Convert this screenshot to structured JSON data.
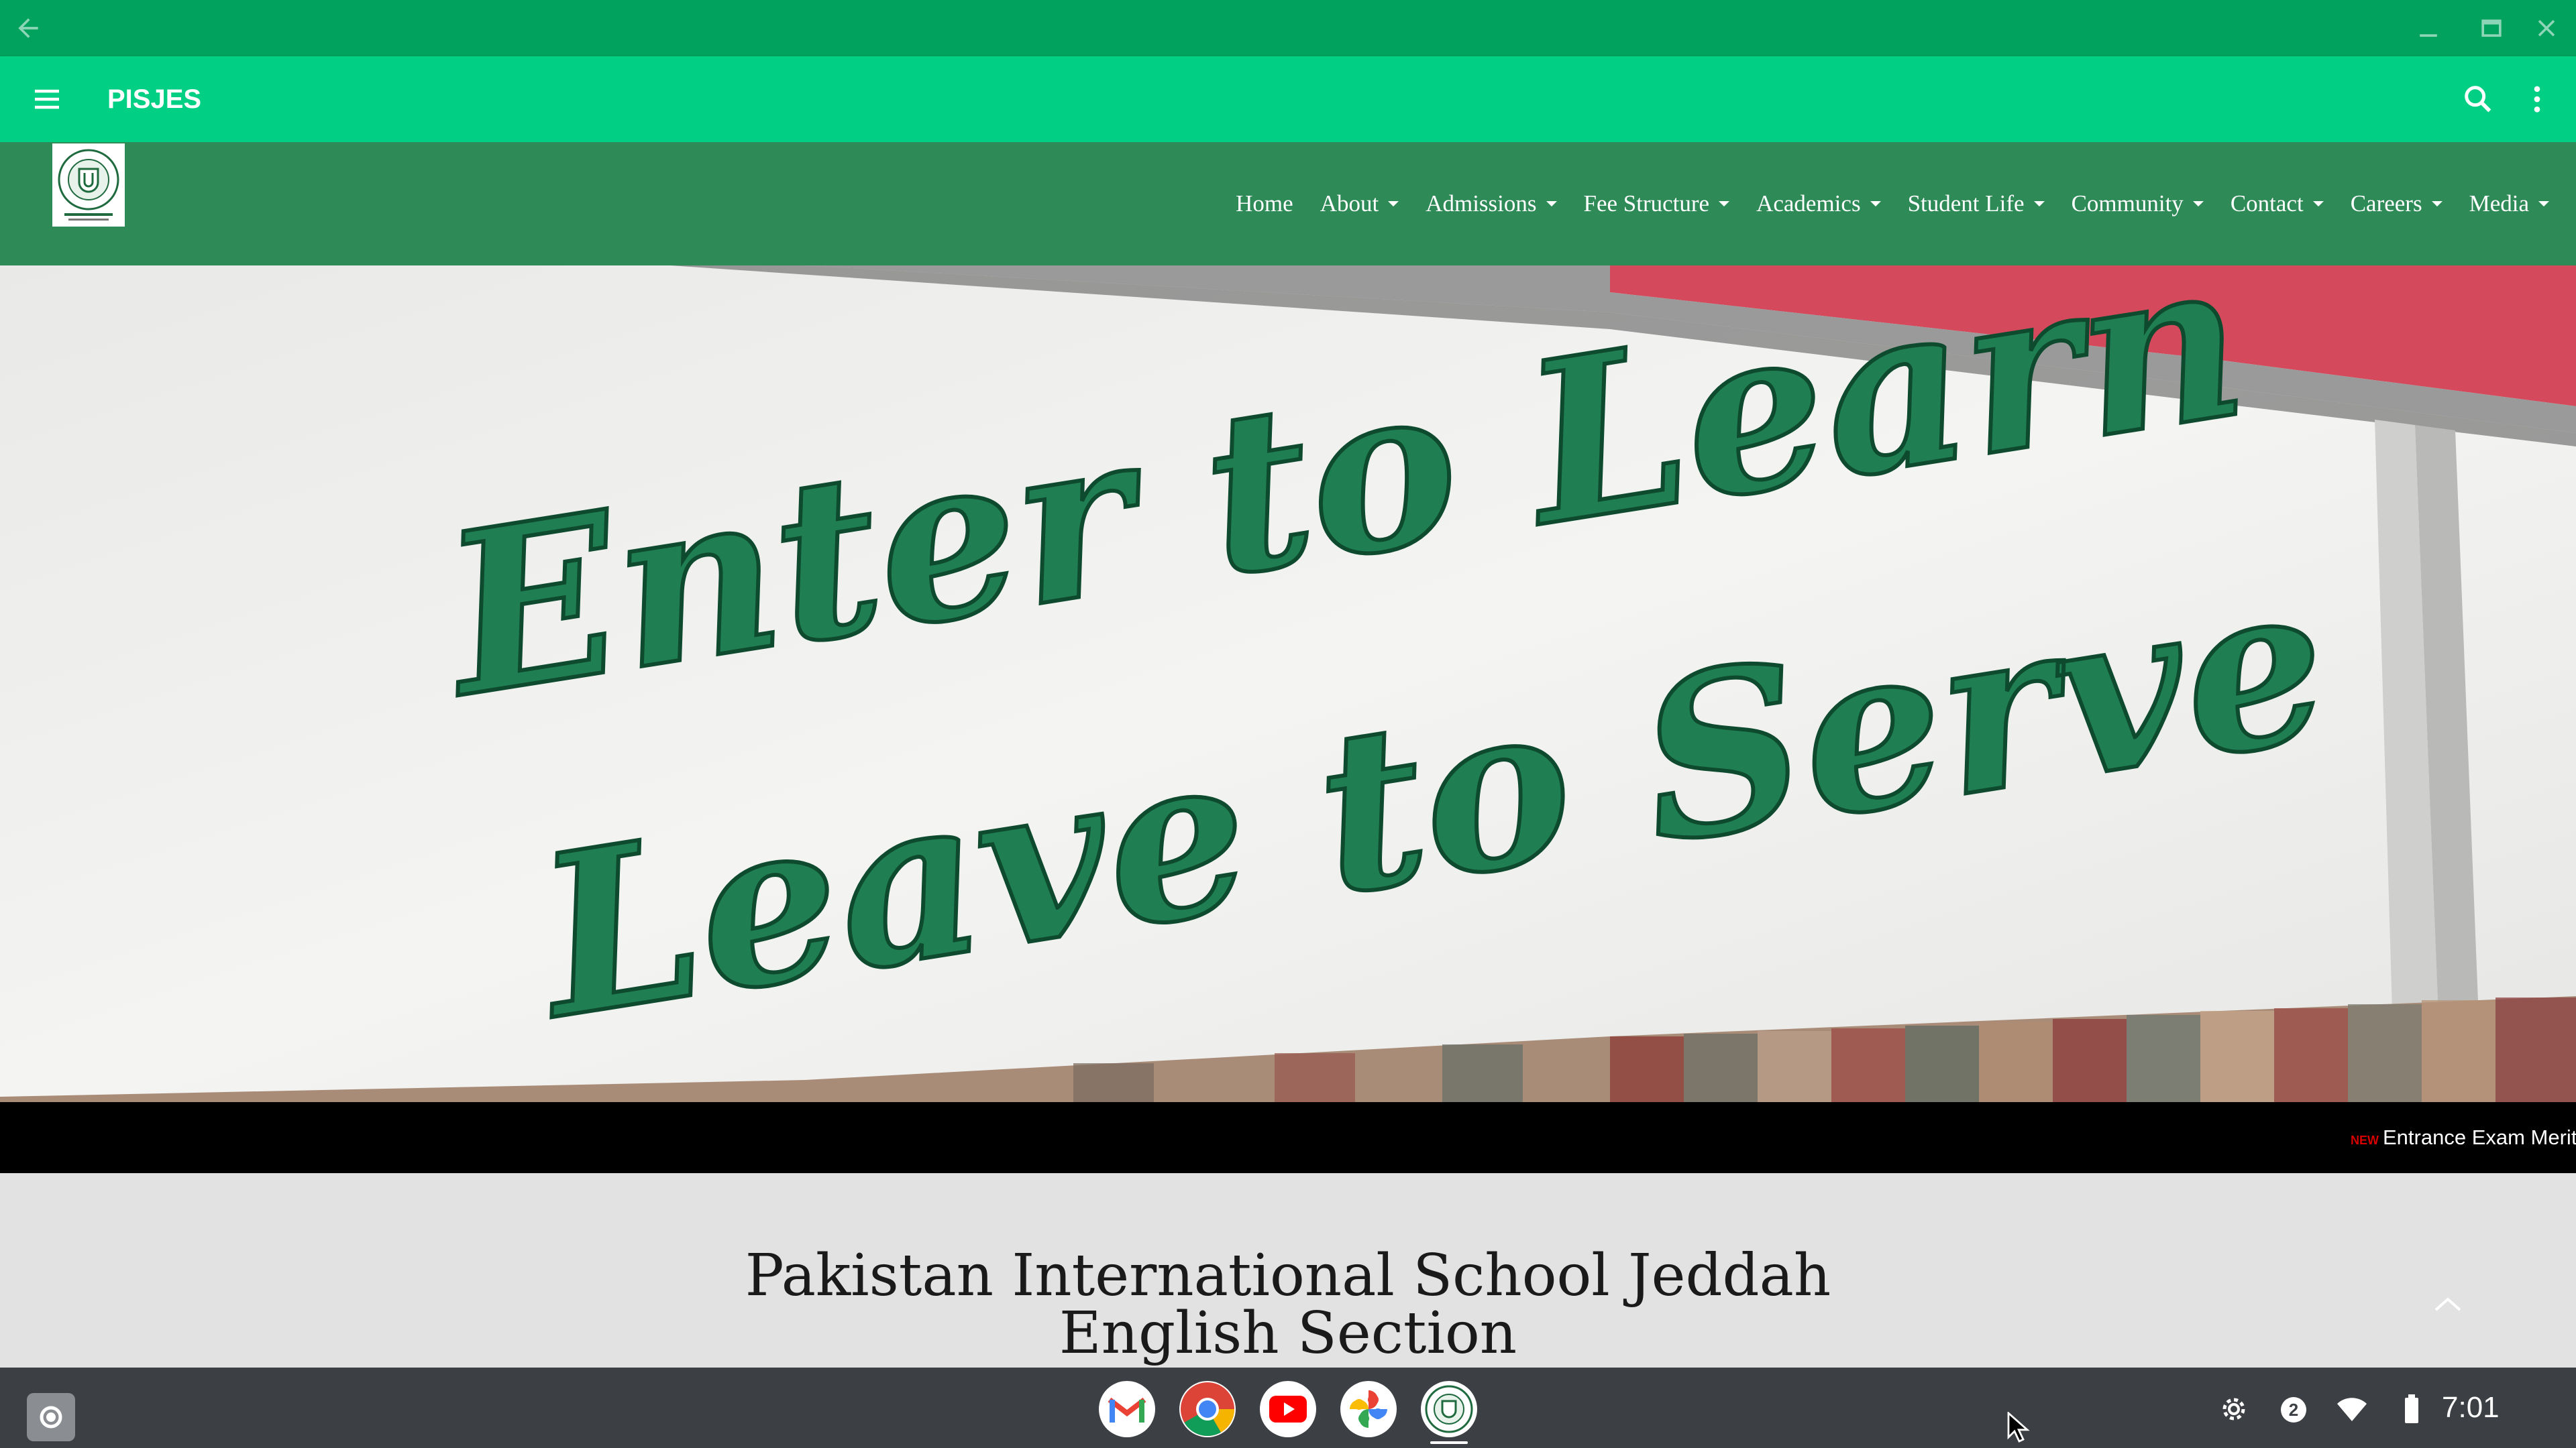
{
  "window": {
    "controls": [
      "back-arrow-icon",
      "minimize-icon",
      "restore-icon",
      "close-icon"
    ]
  },
  "appbar": {
    "title": "PISJES",
    "icons": [
      "hamburger-menu-icon",
      "search-icon",
      "more-vert-icon"
    ]
  },
  "site": {
    "logo_alt": "Pakistan International School Jeddah logo",
    "nav": [
      {
        "label": "Home",
        "dropdown": false
      },
      {
        "label": "About",
        "dropdown": true
      },
      {
        "label": "Admissions",
        "dropdown": true
      },
      {
        "label": "Fee Structure",
        "dropdown": true
      },
      {
        "label": "Academics",
        "dropdown": true
      },
      {
        "label": "Student Life",
        "dropdown": true
      },
      {
        "label": "Community",
        "dropdown": true
      },
      {
        "label": "Contact",
        "dropdown": true
      },
      {
        "label": "Careers",
        "dropdown": true
      },
      {
        "label": "Media",
        "dropdown": true
      }
    ]
  },
  "hero": {
    "line1": "Enter to Learn",
    "line2": "Leave to Serve"
  },
  "ticker": {
    "badge": "NEW",
    "text": "Entrance Exam Merit"
  },
  "main": {
    "title_line1": "Pakistan International School Jeddah",
    "title_line2": "English Section"
  },
  "shelf": {
    "apps": [
      "Gmail",
      "Chrome",
      "YouTube",
      "Photos",
      "PISJES"
    ],
    "notification_count": "2",
    "time": "7:01"
  },
  "colors": {
    "titlebar": "#00a25e",
    "appbar": "#00cf84",
    "site_header": "#2e8b57",
    "sign_green": "#1f7f52",
    "ticker_bg": "#000000",
    "shelf": "#3c3f43"
  }
}
